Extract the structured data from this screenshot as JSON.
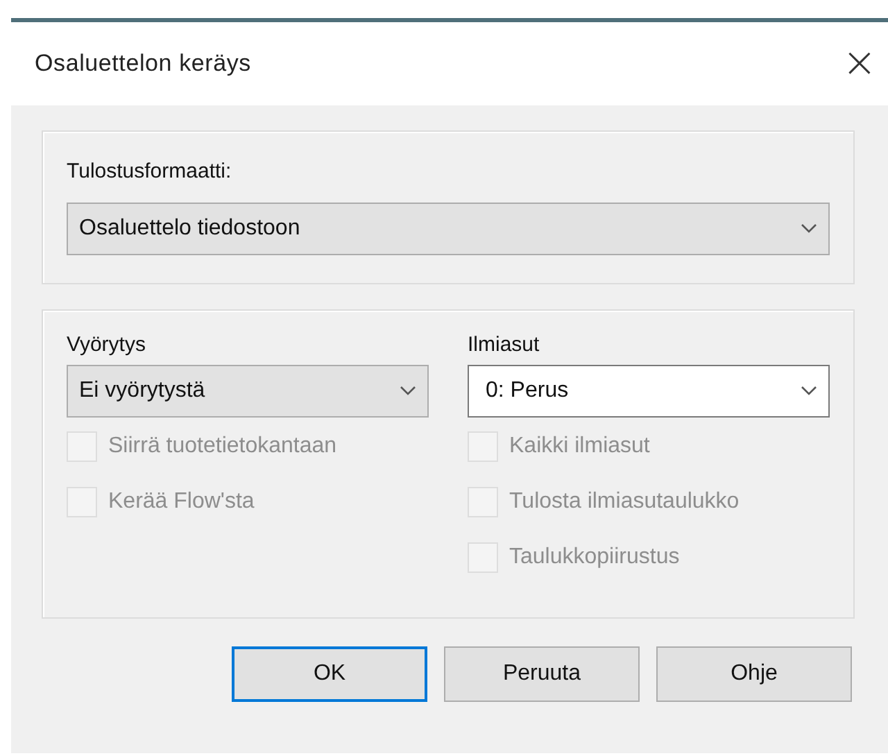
{
  "window": {
    "title": "Osaluettelon keräys",
    "close": "×"
  },
  "format_group": {
    "label": "Tulostusformaatti:",
    "dropdown": {
      "kind": "list",
      "value": "Osaluettelo tiedostoon"
    }
  },
  "columns": [
    {
      "label": "Vyörytys",
      "dropdown": {
        "kind": "list",
        "value": "Ei vyörytystä"
      },
      "checkboxes": [
        {
          "label": "Siirrä tuotetietokantaan",
          "checked": false,
          "disabled": true
        },
        {
          "label": "Kerää Flow'sta",
          "checked": false,
          "disabled": true
        }
      ]
    },
    {
      "label": "Ilmiasut",
      "dropdown": {
        "kind": "edit",
        "value": "0: Perus"
      },
      "checkboxes": [
        {
          "label": "Kaikki ilmiasut",
          "checked": false,
          "disabled": true
        },
        {
          "label": "Tulosta ilmiasutaulukko",
          "checked": false,
          "disabled": true
        },
        {
          "label": "Taulukkopiirustus",
          "checked": false,
          "disabled": true
        }
      ]
    }
  ],
  "buttons": [
    {
      "label": "OK",
      "default": true
    },
    {
      "label": "Peruuta",
      "default": false
    },
    {
      "label": "Ohje",
      "default": false
    }
  ]
}
